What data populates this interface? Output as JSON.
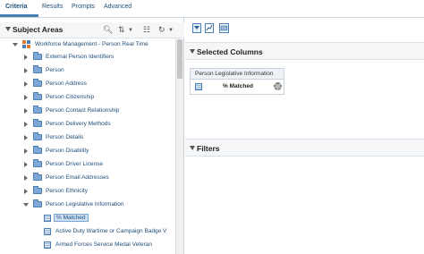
{
  "tabs": [
    {
      "label": "Criteria",
      "active": true
    },
    {
      "label": "Results",
      "active": false
    },
    {
      "label": "Prompts",
      "active": false
    },
    {
      "label": "Advanced",
      "active": false
    }
  ],
  "subject_areas": {
    "title": "Subject Areas",
    "tools": [
      "search-icon",
      "sort-icon",
      "tree-icon",
      "refresh-icon"
    ],
    "root": {
      "label": "Workforce Management - Person Real Time",
      "expanded": true
    },
    "folders": [
      {
        "label": "External Person Identifiers",
        "expanded": false
      },
      {
        "label": "Person",
        "expanded": false
      },
      {
        "label": "Person Address",
        "expanded": false
      },
      {
        "label": "Person Citizenship",
        "expanded": false
      },
      {
        "label": "Person Contact Relationship",
        "expanded": false
      },
      {
        "label": "Person Delivery Methods",
        "expanded": false
      },
      {
        "label": "Person Details",
        "expanded": false
      },
      {
        "label": "Person Disability",
        "expanded": false
      },
      {
        "label": "Person Driver License",
        "expanded": false
      },
      {
        "label": "Person Email Addresses",
        "expanded": false
      },
      {
        "label": "Person Ethnicity",
        "expanded": false
      },
      {
        "label": "Person Legislative Information",
        "expanded": true
      }
    ],
    "columns": [
      {
        "label": "% Matched",
        "selected": true
      },
      {
        "label": "Active Duty Wartime or Campaign Badge V",
        "selected": false
      },
      {
        "label": "Armed Forces Service Medal Veteran",
        "selected": false
      }
    ]
  },
  "criteria": {
    "toolbar": [
      "filter-icon",
      "chart-icon",
      "sql-icon"
    ],
    "selected_columns_title": "Selected Columns",
    "selected_column_card": {
      "folder": "Person Legislative Information",
      "column": "% Matched"
    },
    "filters_title": "Filters"
  },
  "colors": {
    "accent": "#4a7fb5",
    "link_text": "#1f4e79",
    "header_bg": "#f4f6f8",
    "selection_bg": "#cfe0f5"
  }
}
